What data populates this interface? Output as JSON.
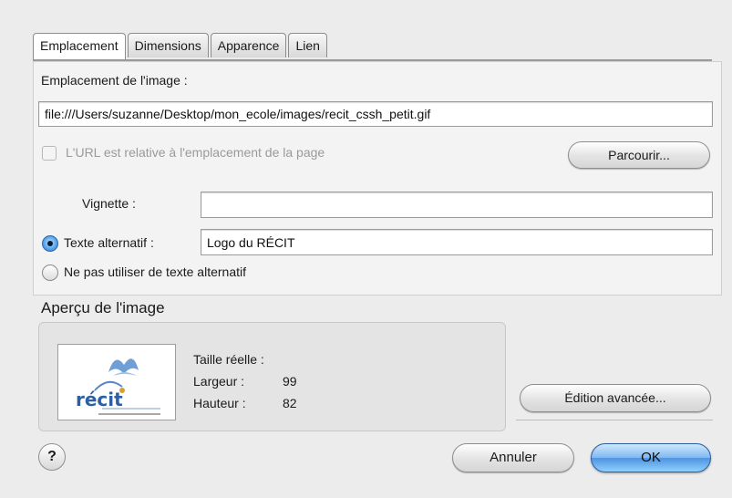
{
  "tabs": [
    "Emplacement",
    "Dimensions",
    "Apparence",
    "Lien"
  ],
  "active_tab": "Emplacement",
  "location": {
    "label": "Emplacement de l'image :",
    "value": "file:///Users/suzanne/Desktop/mon_ecole/images/recit_cssh_petit.gif",
    "relative_checkbox_label": "L'URL est relative à l'emplacement de la page",
    "browse_button": "Parcourir..."
  },
  "vignette": {
    "label": "Vignette :",
    "value": ""
  },
  "alt_text": {
    "radio_label": "Texte alternatif :",
    "value": "Logo du RÉCIT",
    "checked": true,
    "no_alt_label": "Ne pas utiliser de texte alternatif"
  },
  "preview": {
    "title": "Aperçu de l'image",
    "real_size_label": "Taille réelle :",
    "width_label": "Largeur :",
    "width_value": "99",
    "height_label": "Hauteur :",
    "height_value": "82",
    "logo_text": "récit"
  },
  "buttons": {
    "advanced": "Édition avancée...",
    "help": "?",
    "cancel": "Annuler",
    "ok": "OK"
  }
}
